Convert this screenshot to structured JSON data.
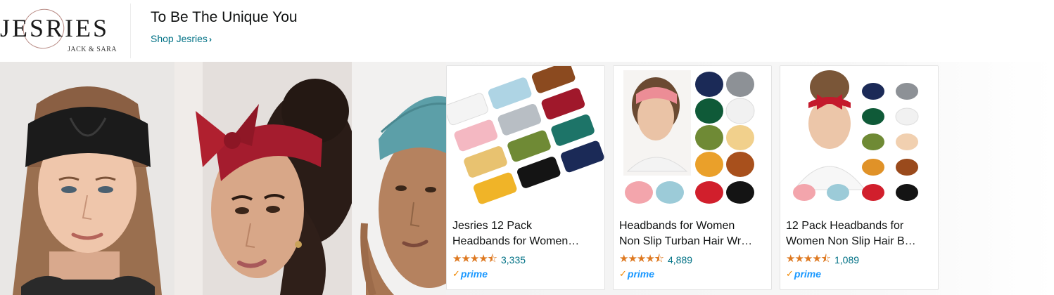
{
  "header": {
    "logo_text": "JESRIES",
    "logo_subtext": "JACK & SARA",
    "slogan": "To Be The Unique You",
    "shop_link": "Shop Jesries"
  },
  "banner_photos": [
    {
      "name": "woman-black-twist-headband"
    },
    {
      "name": "woman-red-bow-headband"
    },
    {
      "name": "woman-teal-turban-headband"
    }
  ],
  "products": [
    {
      "title_line1": "Jesries 12 Pack",
      "title_line2": "Headbands for Women…",
      "rating": 4.5,
      "rating_count": "3,335",
      "prime": "prime"
    },
    {
      "title_line1": "Headbands for Women",
      "title_line2": "Non Slip Turban Hair Wr…",
      "rating": 4.5,
      "rating_count": "4,889",
      "prime": "prime"
    },
    {
      "title_line1": "12 Pack Headbands for",
      "title_line2": "Women Non Slip Hair B…",
      "rating": 4.5,
      "rating_count": "1,089",
      "prime": "prime"
    }
  ],
  "colors": {
    "link": "#007185",
    "star": "#de7921",
    "prime_blue": "#1a98ff",
    "prime_check": "#f08804"
  }
}
